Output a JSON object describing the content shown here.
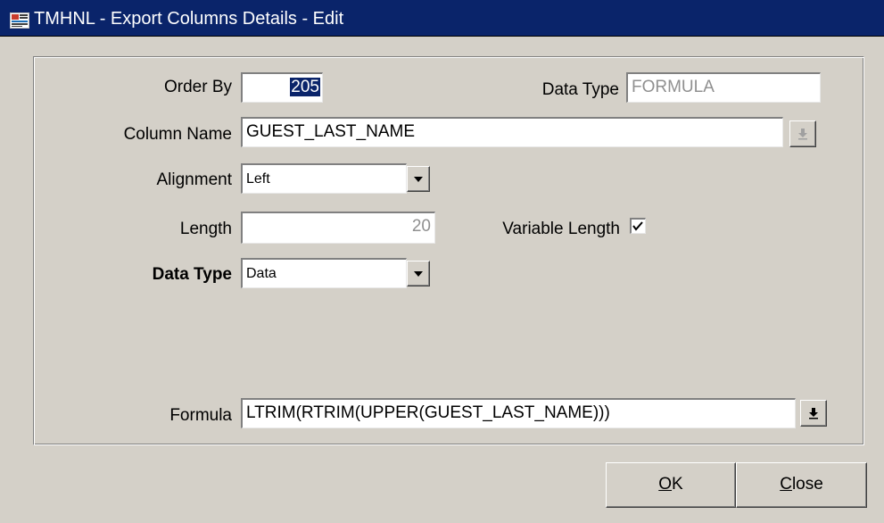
{
  "window": {
    "title": "TMHNL - Export Columns Details - Edit",
    "icon": "oracle-form-icon"
  },
  "form": {
    "order_by": {
      "label": "Order By",
      "value": "205"
    },
    "data_type_readonly": {
      "label": "Data Type",
      "value": "FORMULA"
    },
    "column_name": {
      "label": "Column Name",
      "value": "GUEST_LAST_NAME"
    },
    "alignment": {
      "label": "Alignment",
      "value": "Left"
    },
    "length": {
      "label": "Length",
      "value": "20"
    },
    "variable_length": {
      "label": "Variable Length",
      "checked": true
    },
    "data_type": {
      "label": "Data Type",
      "value": "Data"
    },
    "formula": {
      "label": "Formula",
      "value": "LTRIM(RTRIM(UPPER(GUEST_LAST_NAME)))"
    }
  },
  "buttons": {
    "ok": {
      "mnemonic": "O",
      "rest": "K"
    },
    "close": {
      "mnemonic": "C",
      "rest": "lose"
    }
  },
  "icons": {
    "dropdown": "chevron-down-icon",
    "lov": "download-arrow-icon",
    "check": "checkmark-icon"
  },
  "colors": {
    "titlebar": "#0a246a",
    "dialog_bg": "#d4d0c8",
    "selection": "#0a246a"
  }
}
